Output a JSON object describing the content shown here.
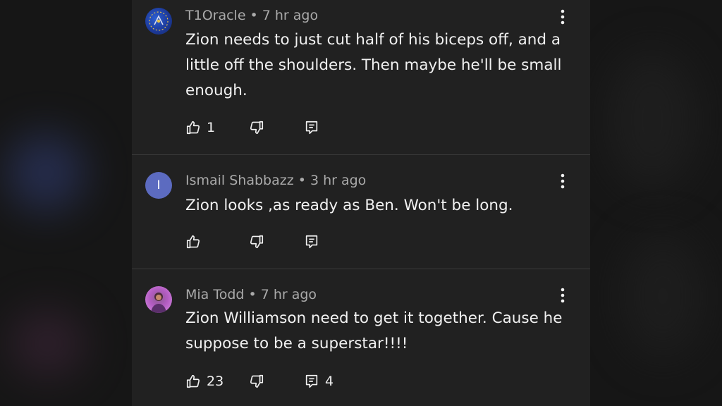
{
  "comments": [
    {
      "author": "T1Oracle",
      "time": "7 hr ago",
      "text": "Zion needs to just cut half of his biceps off, and a little off the shoulders. Then maybe he'll be small enough.",
      "likes": "1",
      "replies": "",
      "avatar_icon": "globe-icon"
    },
    {
      "author": "Ismail Shabbazz",
      "time": "3 hr ago",
      "text": "Zion looks ,as ready as Ben. Won't be long.",
      "likes": "",
      "replies": "",
      "avatar_letter": "I",
      "avatar_color": "#5c6bc0"
    },
    {
      "author": "Mia Todd",
      "time": "7 hr ago",
      "text": "Zion Williamson need to get it together. Cause he suppose to be a superstar!!!!",
      "likes": "23",
      "replies": "4",
      "avatar_icon": "photo-icon"
    }
  ],
  "separator": "•",
  "colors": {
    "panel_bg": "#212121",
    "primary_text": "#f1f1f1",
    "secondary_text": "#aaaaaa",
    "letter_avatar": "#5c6bc0"
  }
}
